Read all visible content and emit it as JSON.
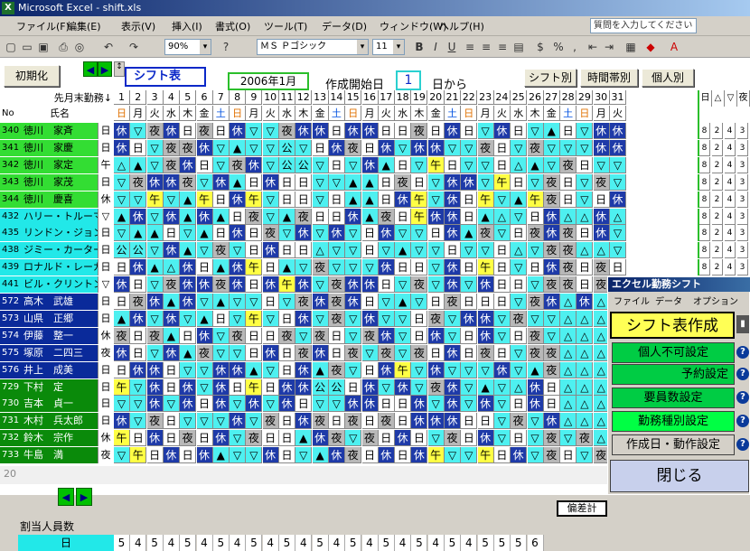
{
  "window": {
    "title": "Microsoft Excel - shift.xls"
  },
  "menu": [
    "ファイル(F)",
    "編集(E)",
    "表示(V)",
    "挿入(I)",
    "書式(O)",
    "ツール(T)",
    "データ(D)",
    "ウィンドウ(W)",
    "ヘルプ(H)"
  ],
  "help_placeholder": "質問を入力してください",
  "toolbar": {
    "zoom": "90%",
    "font": "ＭＳ Ｐゴシック",
    "size": "11"
  },
  "header": {
    "init_button": "初期化",
    "shift_table_label": "シフト表",
    "month": "2006年1月",
    "start_label": "作成開始日",
    "start_day": "1",
    "from_label": "日から",
    "view_buttons": [
      "シフト別",
      "時間帯別",
      "個人別"
    ],
    "prev_month_label": "先月末勤務↓",
    "no_label": "No",
    "name_label": "氏名"
  },
  "days": [
    "1",
    "2",
    "3",
    "4",
    "5",
    "6",
    "7",
    "8",
    "9",
    "10",
    "11",
    "12",
    "13",
    "14",
    "15",
    "16",
    "17",
    "18",
    "19",
    "20",
    "21",
    "22",
    "23",
    "24",
    "25",
    "26",
    "27",
    "28",
    "29",
    "30",
    "31"
  ],
  "weekdays": [
    "日",
    "月",
    "火",
    "水",
    "木",
    "金",
    "土",
    "日",
    "月",
    "火",
    "水",
    "木",
    "金",
    "土",
    "日",
    "月",
    "火",
    "水",
    "木",
    "金",
    "土",
    "日",
    "月",
    "火",
    "水",
    "木",
    "金",
    "土",
    "日",
    "月",
    "火"
  ],
  "stat_headers": [
    "日",
    "△",
    "▽",
    "夜"
  ],
  "stat_values": [
    "8",
    "2",
    "4",
    "3"
  ],
  "employees": [
    {
      "no": "340",
      "name": "徳川　家斉",
      "prev": "日"
    },
    {
      "no": "341",
      "name": "徳川　家慶",
      "prev": "日"
    },
    {
      "no": "342",
      "name": "徳川　家定",
      "prev": "午"
    },
    {
      "no": "343",
      "name": "徳川　家茂",
      "prev": "日"
    },
    {
      "no": "344",
      "name": "徳川　慶喜",
      "prev": "休"
    },
    {
      "no": "432",
      "name": "ハリー・トルーマン",
      "prev": "▽"
    },
    {
      "no": "435",
      "name": "リンドン・ジョンソン",
      "prev": "日"
    },
    {
      "no": "438",
      "name": "ジミー・カーター",
      "prev": "日"
    },
    {
      "no": "439",
      "name": "ロナルド・レーガン",
      "prev": "日"
    },
    {
      "no": "441",
      "name": "ビル・クリントン",
      "prev": "▽"
    },
    {
      "no": "572",
      "name": "高木　武雄",
      "prev": "日"
    },
    {
      "no": "573",
      "name": "山県　正郷",
      "prev": "日"
    },
    {
      "no": "574",
      "name": "伊藤　整一",
      "prev": "休"
    },
    {
      "no": "575",
      "name": "塚原　二四三",
      "prev": "夜"
    },
    {
      "no": "576",
      "name": "井上　成美",
      "prev": "日"
    },
    {
      "no": "729",
      "name": "下村　定",
      "prev": "日"
    },
    {
      "no": "730",
      "name": "吉本　貞一",
      "prev": "日"
    },
    {
      "no": "731",
      "name": "木村　兵太郎",
      "prev": "日"
    },
    {
      "no": "732",
      "name": "鈴木　宗作",
      "prev": "休"
    },
    {
      "no": "733",
      "name": "牛島　満",
      "prev": "夜"
    }
  ],
  "footer": {
    "row_num": "20",
    "assign_label": "割当人員数",
    "day_label": "日",
    "deviation_label": "偏差計",
    "assign_values": [
      "5",
      "4",
      "5",
      "4",
      "5",
      "4",
      "5",
      "4",
      "5",
      "4",
      "5",
      "4",
      "5",
      "4",
      "5",
      "4",
      "5",
      "4",
      "5",
      "4",
      "5",
      "4",
      "5",
      "5",
      "5",
      "6"
    ]
  },
  "panel": {
    "title": "エクセル勤務シフト",
    "menu": [
      "ファイル",
      "データ",
      "オプション"
    ],
    "buttons": [
      "シフト表作成",
      "個人不可設定",
      "予約設定",
      "要員数設定",
      "勤務種別設定",
      "作成日・動作設定",
      "閉じる"
    ]
  },
  "colors": {
    "休": "#1e3aa8",
    "日": "#ffffff",
    "△": "#4ef0f0",
    "▽": "#4ef0f0",
    "夜": "#b8b8b8",
    "午": "#ffff44",
    "公": "#4ef0f0",
    "▲": "#00cc44",
    "A": "#4ef0f0"
  },
  "schedule": [
    "休▽夜休日夜日休▽▽夜休休日休休日日夜日休日▽休日▽▲日▽休休",
    "休日▽夜夜休▽▲▽▽公▽日休夜日休▽休休▽▽夜日▽夜▽▽▽休休",
    "△▲▽夜休日▽夜休▽公公▽日▽休▲日▽午日▽▽日△▲▽夜日▽▽",
    "▽夜休休夜▽休▲日休日日▽▽▲▲日夜日▽休休▽午日▽夜日▽夜▽",
    "▽▽午▽▲午日休午▽日日▽日▲▲日休午▽休日午▽▲午夜日▽日休",
    "▲休▽休▲休▲日夜▽▲夜日日休▲夜日午休休日▲△▽日休△△休△",
    "▽▲▲日▽▲日休日夜▽休▽休▽日休▽▽日休▲夜▽日夜休夜日休▽",
    "公公▽休▲▽夜▽日休日日△▽▽日▽▲▽▽日▽▽日△▽夜夜△△▽",
    "日休▲△休日▲休午日▲▽夜▽▽▽休日日▽休日午日▽日休夜日夜日",
    "休日▽夜休休夜休日休午休▽夜休休日▽夜▽休▽休日日▽夜夜日夜夜",
    "日夜休▲休▽▲▽▽日▽夜休夜休日▽▲▽日夜日日日▽夜休△休△△",
    "▲休▽休▽▲日▽午▽日休▽夜▽休▽▽日夜▽休休▽夜▽▽△△△△",
    "夜日夜▲日休▽夜日日夜▽夜日▽夜休▽日休▽日休▽日夜▽△△△△",
    "休日▽休▲夜▽▽日休日夜休日夜▽夜▽夜日休日夜日▽夜夜△△△△",
    "日休休日▽▽休休▲▽日休▲夜▽日休午▽休▽▽▽休▽▲夜△△△△",
    "午▽休日休▽休日午日休休公公日休▽休▽夜休▽▲▽△休日△△△△",
    "▽▽休▽休日休▽休▽休日▽▽休休日日休▽休▽休▽日休日△△△△",
    "休▽夜日▽▽▽休▽夜日休夜日夜日夜日休休休日日▽夜▽休△△△△",
    "午日休日夜日休▽夜日日▲休夜▽夜日休日▽夜日休▽日▽夜▽夜△△",
    "▽午日休日休▲▽▽休日▽▲休夜日休日休午▽▽午日休▽夜日▽夜夜"
  ]
}
